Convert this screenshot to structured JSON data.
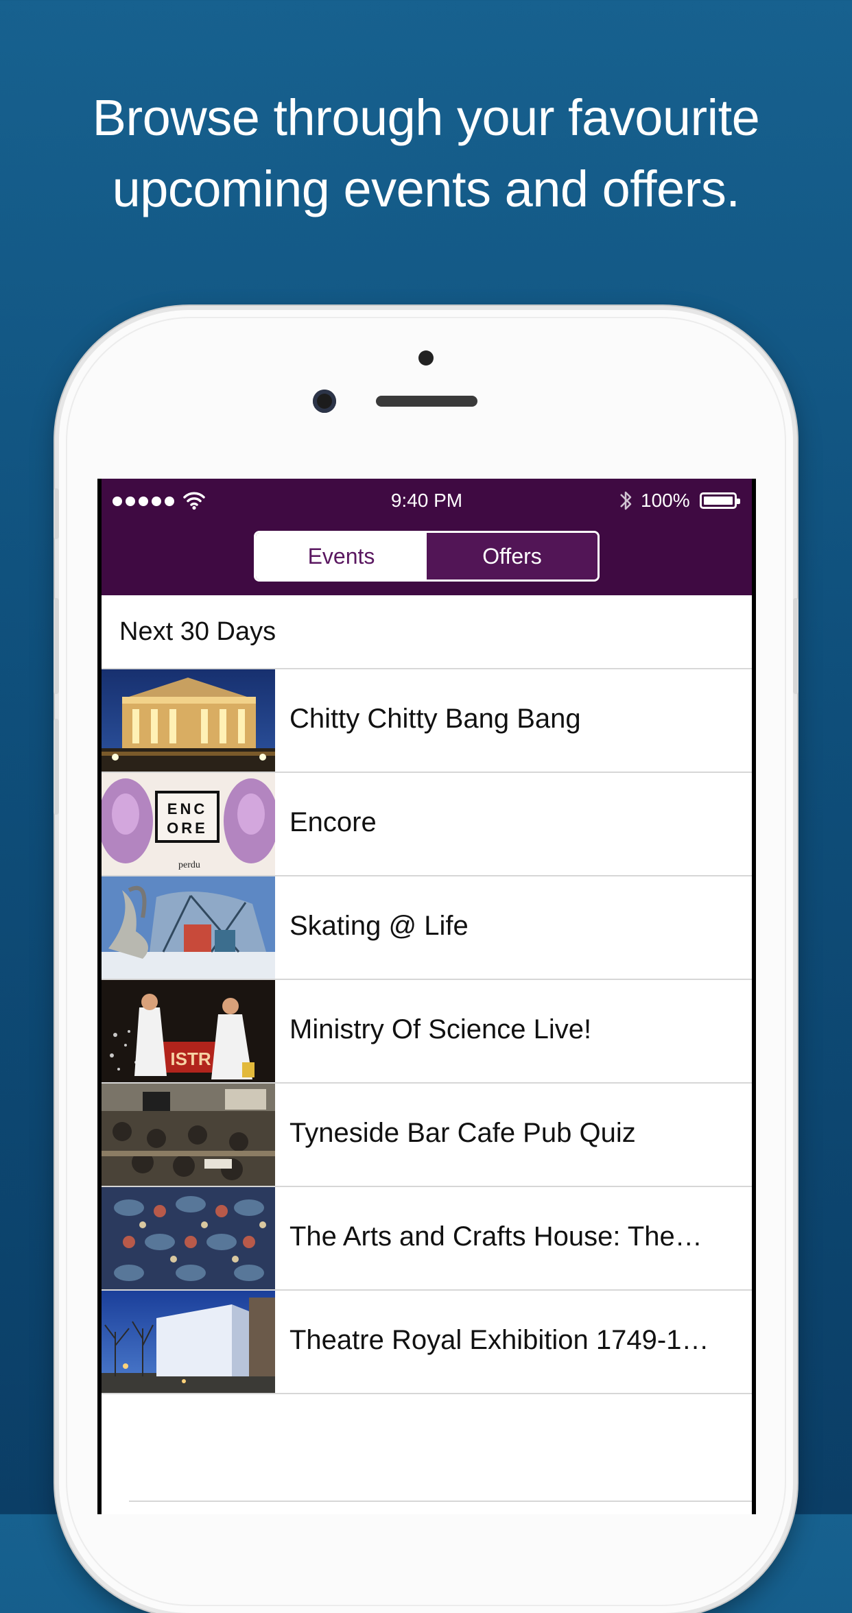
{
  "headline": {
    "line1": "Browse through your favourite",
    "line2": "upcoming events and offers."
  },
  "status_bar": {
    "time": "9:40 PM",
    "battery_text": "100%",
    "battery_level": 1.0,
    "signal_bars": 5,
    "icons": [
      "signal-dots-icon",
      "wifi-icon",
      "bluetooth-icon",
      "battery-icon"
    ]
  },
  "segmented_control": {
    "events_label": "Events",
    "offers_label": "Offers",
    "selected": "Events"
  },
  "section": {
    "title": "Next 30 Days"
  },
  "events": [
    {
      "title": "Chitty Chitty Bang Bang"
    },
    {
      "title": "Encore",
      "thumb_text": [
        "ENC",
        "ORE",
        "perdu"
      ]
    },
    {
      "title": "Skating @ Life"
    },
    {
      "title": "Ministry Of Science Live!",
      "thumb_text": "ISTR"
    },
    {
      "title": "Tyneside Bar Cafe Pub Quiz"
    },
    {
      "title": "The Arts and Crafts House: The…"
    },
    {
      "title": "Theatre Royal Exhibition 1749-1…"
    }
  ],
  "colors": {
    "background_top": "#17618f",
    "background_bottom": "#0b3e66",
    "nav_purple": "#3f0a42",
    "segment_inactive": "#521556",
    "segment_active_text": "#5a1760"
  }
}
